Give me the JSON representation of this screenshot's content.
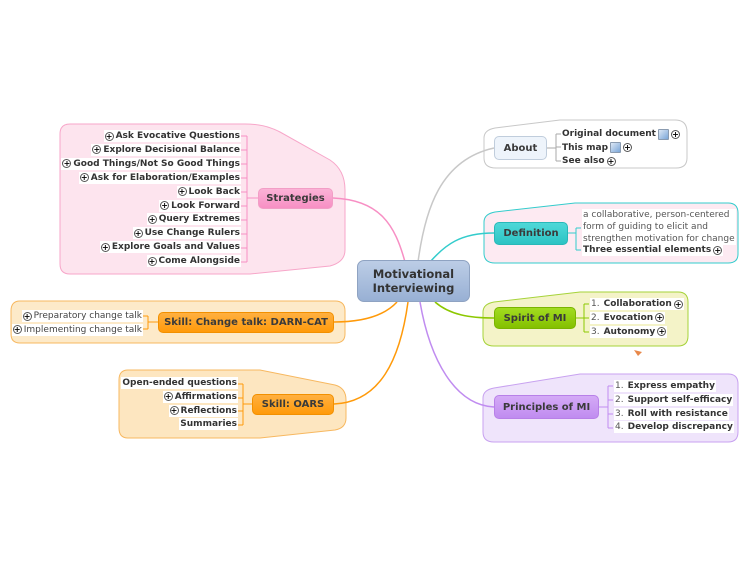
{
  "central": {
    "label_line1": "Motivational",
    "label_line2": "Interviewing"
  },
  "colors": {
    "central_fill": "#a7bbd9",
    "strategies": "#f78fc4",
    "strategies_boundary": "#fde4ee",
    "about": "#c8c8c8",
    "about_fill": "#eef4fb",
    "definition": "#33cccc",
    "definition_boundary": "#fdeaf2",
    "spirit": "#8cc800",
    "spirit_boundary": "#f4f3c8",
    "principles": "#c08cf0",
    "principles_boundary": "#efe4fb",
    "darn": "#ff9a0a",
    "darn_boundary": "#fdeac9",
    "oars": "#ff9a0a",
    "oars_boundary": "#fde6c0"
  },
  "strategies": {
    "label": "Strategies",
    "items": [
      {
        "label": "Ask Evocative Questions",
        "expand": true
      },
      {
        "label": "Explore Decisional  Balance",
        "expand": true
      },
      {
        "label": "Good  Things/Not So Good  Things",
        "expand": true
      },
      {
        "label": "Ask  for Elaboration/Examples",
        "expand": true
      },
      {
        "label": "Look Back",
        "expand": true
      },
      {
        "label": "Look  Forward",
        "expand": true
      },
      {
        "label": "Query  Extremes",
        "expand": true
      },
      {
        "label": "Use Change Rulers",
        "expand": true
      },
      {
        "label": "Explore Goals and Values",
        "expand": true
      },
      {
        "label": "Come Alongside",
        "expand": true
      }
    ]
  },
  "darn": {
    "label": "Skill: Change talk: DARN-CAT",
    "items": [
      {
        "label": "Preparatory change talk"
      },
      {
        "label": "Implementing change talk"
      }
    ]
  },
  "oars": {
    "label": "Skill: OARS",
    "items": [
      {
        "label": "Open-ended questions"
      },
      {
        "label": "Affirmations"
      },
      {
        "label": "Reflections"
      },
      {
        "label": "Summaries"
      }
    ]
  },
  "about": {
    "label": "About",
    "items": [
      {
        "label": "Original document",
        "icon": "note-icon"
      },
      {
        "label": "This map",
        "icon": "note-icon"
      },
      {
        "label": "See also"
      }
    ]
  },
  "definition": {
    "label": "Definition",
    "text_lines": [
      "a collaborative, person-centered",
      "form of guiding to elicit  and",
      "strengthen motivation for change"
    ],
    "items": [
      {
        "label": "Three essential elements"
      }
    ]
  },
  "spirit": {
    "label": "Spirit of MI",
    "items": [
      {
        "num": "1.",
        "label": "Collaboration"
      },
      {
        "num": "2.",
        "label": "Evocation"
      },
      {
        "num": "3.",
        "label": "Autonomy"
      }
    ]
  },
  "principles": {
    "label": "Principles of MI",
    "items": [
      {
        "num": "1.",
        "label": "Express empathy"
      },
      {
        "num": "2.",
        "label": "Support self-efficacy"
      },
      {
        "num": "3.",
        "label": "Roll with resistance"
      },
      {
        "num": "4.",
        "label": "Develop discrepancy"
      }
    ]
  }
}
